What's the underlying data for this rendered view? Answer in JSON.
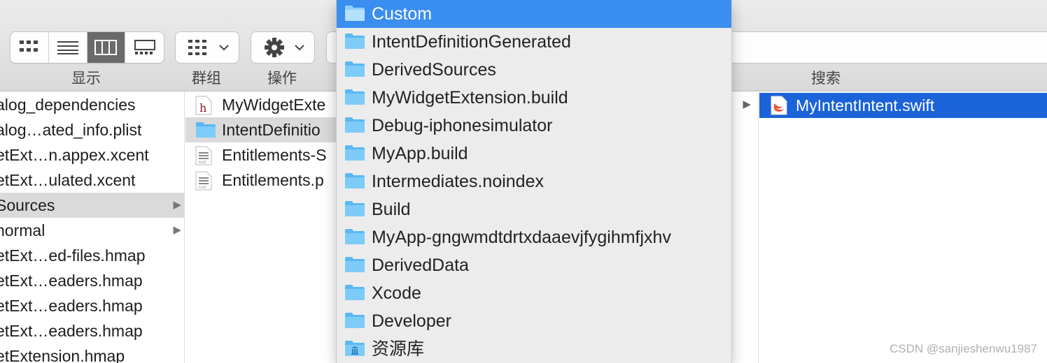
{
  "toolbar": {
    "view_label": "显示",
    "group_label": "群组",
    "action_label": "操作",
    "search_label": "搜索",
    "view_buttons": [
      "icon-view-icon",
      "list-view-icon",
      "column-view-icon",
      "gallery-view-icon"
    ],
    "active_view": "column-view-icon"
  },
  "column1": {
    "items": [
      {
        "label": "alog_dependencies"
      },
      {
        "label": "alog…ated_info.plist"
      },
      {
        "label": "etExt…n.appex.xcent"
      },
      {
        "label": "etExt…ulated.xcent"
      },
      {
        "label": "Sources",
        "selected": true,
        "folder": true
      },
      {
        "label": "normal",
        "folder": true
      },
      {
        "label": "etExt…ed-files.hmap"
      },
      {
        "label": "etExt…eaders.hmap"
      },
      {
        "label": "etExt…eaders.hmap"
      },
      {
        "label": "etExt…eaders.hmap"
      },
      {
        "label": "etExtension.hmap"
      }
    ]
  },
  "column2": {
    "items": [
      {
        "label": "MyWidgetExte",
        "icon": "header-file-icon"
      },
      {
        "label": "IntentDefinitio",
        "icon": "folder-icon",
        "selected": true
      },
      {
        "label": "Entitlements-S",
        "icon": "plist-file-icon"
      },
      {
        "label": "Entitlements.p",
        "icon": "plist-file-icon"
      }
    ]
  },
  "column4": {
    "items": [
      {
        "label": "MyIntentIntent.swift",
        "icon": "swift-file-icon",
        "selected": true
      }
    ]
  },
  "path_menu": {
    "items": [
      {
        "label": "Custom",
        "highlighted": true
      },
      {
        "label": "IntentDefinitionGenerated"
      },
      {
        "label": "DerivedSources"
      },
      {
        "label": "MyWidgetExtension.build"
      },
      {
        "label": "Debug-iphonesimulator"
      },
      {
        "label": "MyApp.build"
      },
      {
        "label": "Intermediates.noindex"
      },
      {
        "label": "Build"
      },
      {
        "label": "MyApp-gngwmdtdrtxdaaevjfygihmfjxhv"
      },
      {
        "label": "DerivedData"
      },
      {
        "label": "Xcode"
      },
      {
        "label": "Developer"
      },
      {
        "label": "资源库",
        "icon": "library-folder-icon"
      }
    ]
  },
  "watermark": "CSDN @sanjieshenwu1987",
  "colors": {
    "menu_highlight": "#3a8ef0",
    "selection_blue": "#1a63d9",
    "folder_blue": "#6cc0f5"
  }
}
